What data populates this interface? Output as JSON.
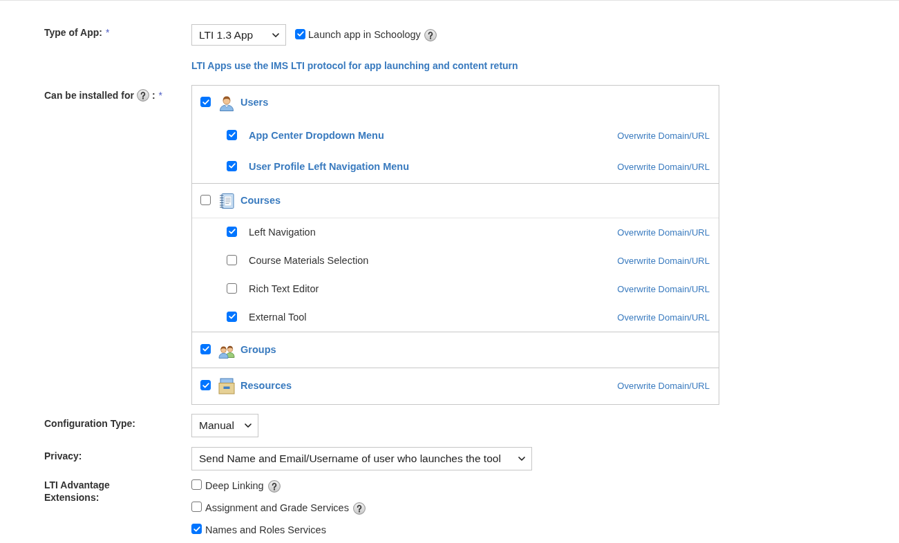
{
  "app_type": {
    "label": "Type of App:",
    "required_mark": "*",
    "select": {
      "value": "LTI 1.3 App"
    },
    "launch_option": {
      "label": "Launch app in Schoology",
      "checked": true,
      "help": true
    },
    "note": "LTI Apps use the IMS LTI protocol for app launching and content return"
  },
  "install_targets": {
    "label": "Can be installed for",
    "help": true,
    "separator": ":",
    "required_mark": "*",
    "sections": [
      {
        "kind": "users",
        "title": "Users",
        "checked": true,
        "items": [
          {
            "kind": "link",
            "label": "App Center Dropdown Menu",
            "checked": true,
            "action": "Overwrite Domain/URL"
          },
          {
            "kind": "link",
            "label": "User Profile Left Navigation Menu",
            "checked": true,
            "action": "Overwrite Domain/URL"
          }
        ]
      },
      {
        "kind": "courses",
        "title": "Courses",
        "checked": false,
        "items": [
          {
            "kind": "plain",
            "label": "Left Navigation",
            "checked": true,
            "action": "Overwrite Domain/URL"
          },
          {
            "kind": "plain",
            "label": "Course Materials Selection",
            "checked": false,
            "action": "Overwrite Domain/URL"
          },
          {
            "kind": "plain",
            "label": "Rich Text Editor",
            "checked": false,
            "action": "Overwrite Domain/URL"
          },
          {
            "kind": "plain",
            "label": "External Tool",
            "checked": true,
            "action": "Overwrite Domain/URL"
          }
        ]
      },
      {
        "kind": "groups",
        "title": "Groups",
        "checked": true
      },
      {
        "kind": "resources",
        "title": "Resources",
        "checked": true,
        "action": "Overwrite Domain/URL"
      }
    ]
  },
  "configuration_type": {
    "label": "Configuration Type:",
    "value": "Manual"
  },
  "privacy": {
    "label": "Privacy:",
    "value": "Send Name and Email/Username of user who launches the tool"
  },
  "extensions": {
    "label": "LTI Advantage Extensions:",
    "options": [
      {
        "label": "Deep Linking",
        "checked": false,
        "help": true
      },
      {
        "label": "Assignment and Grade Services",
        "checked": false,
        "help": true
      },
      {
        "label": "Names and Roles Services",
        "checked": true,
        "help": false
      }
    ]
  }
}
